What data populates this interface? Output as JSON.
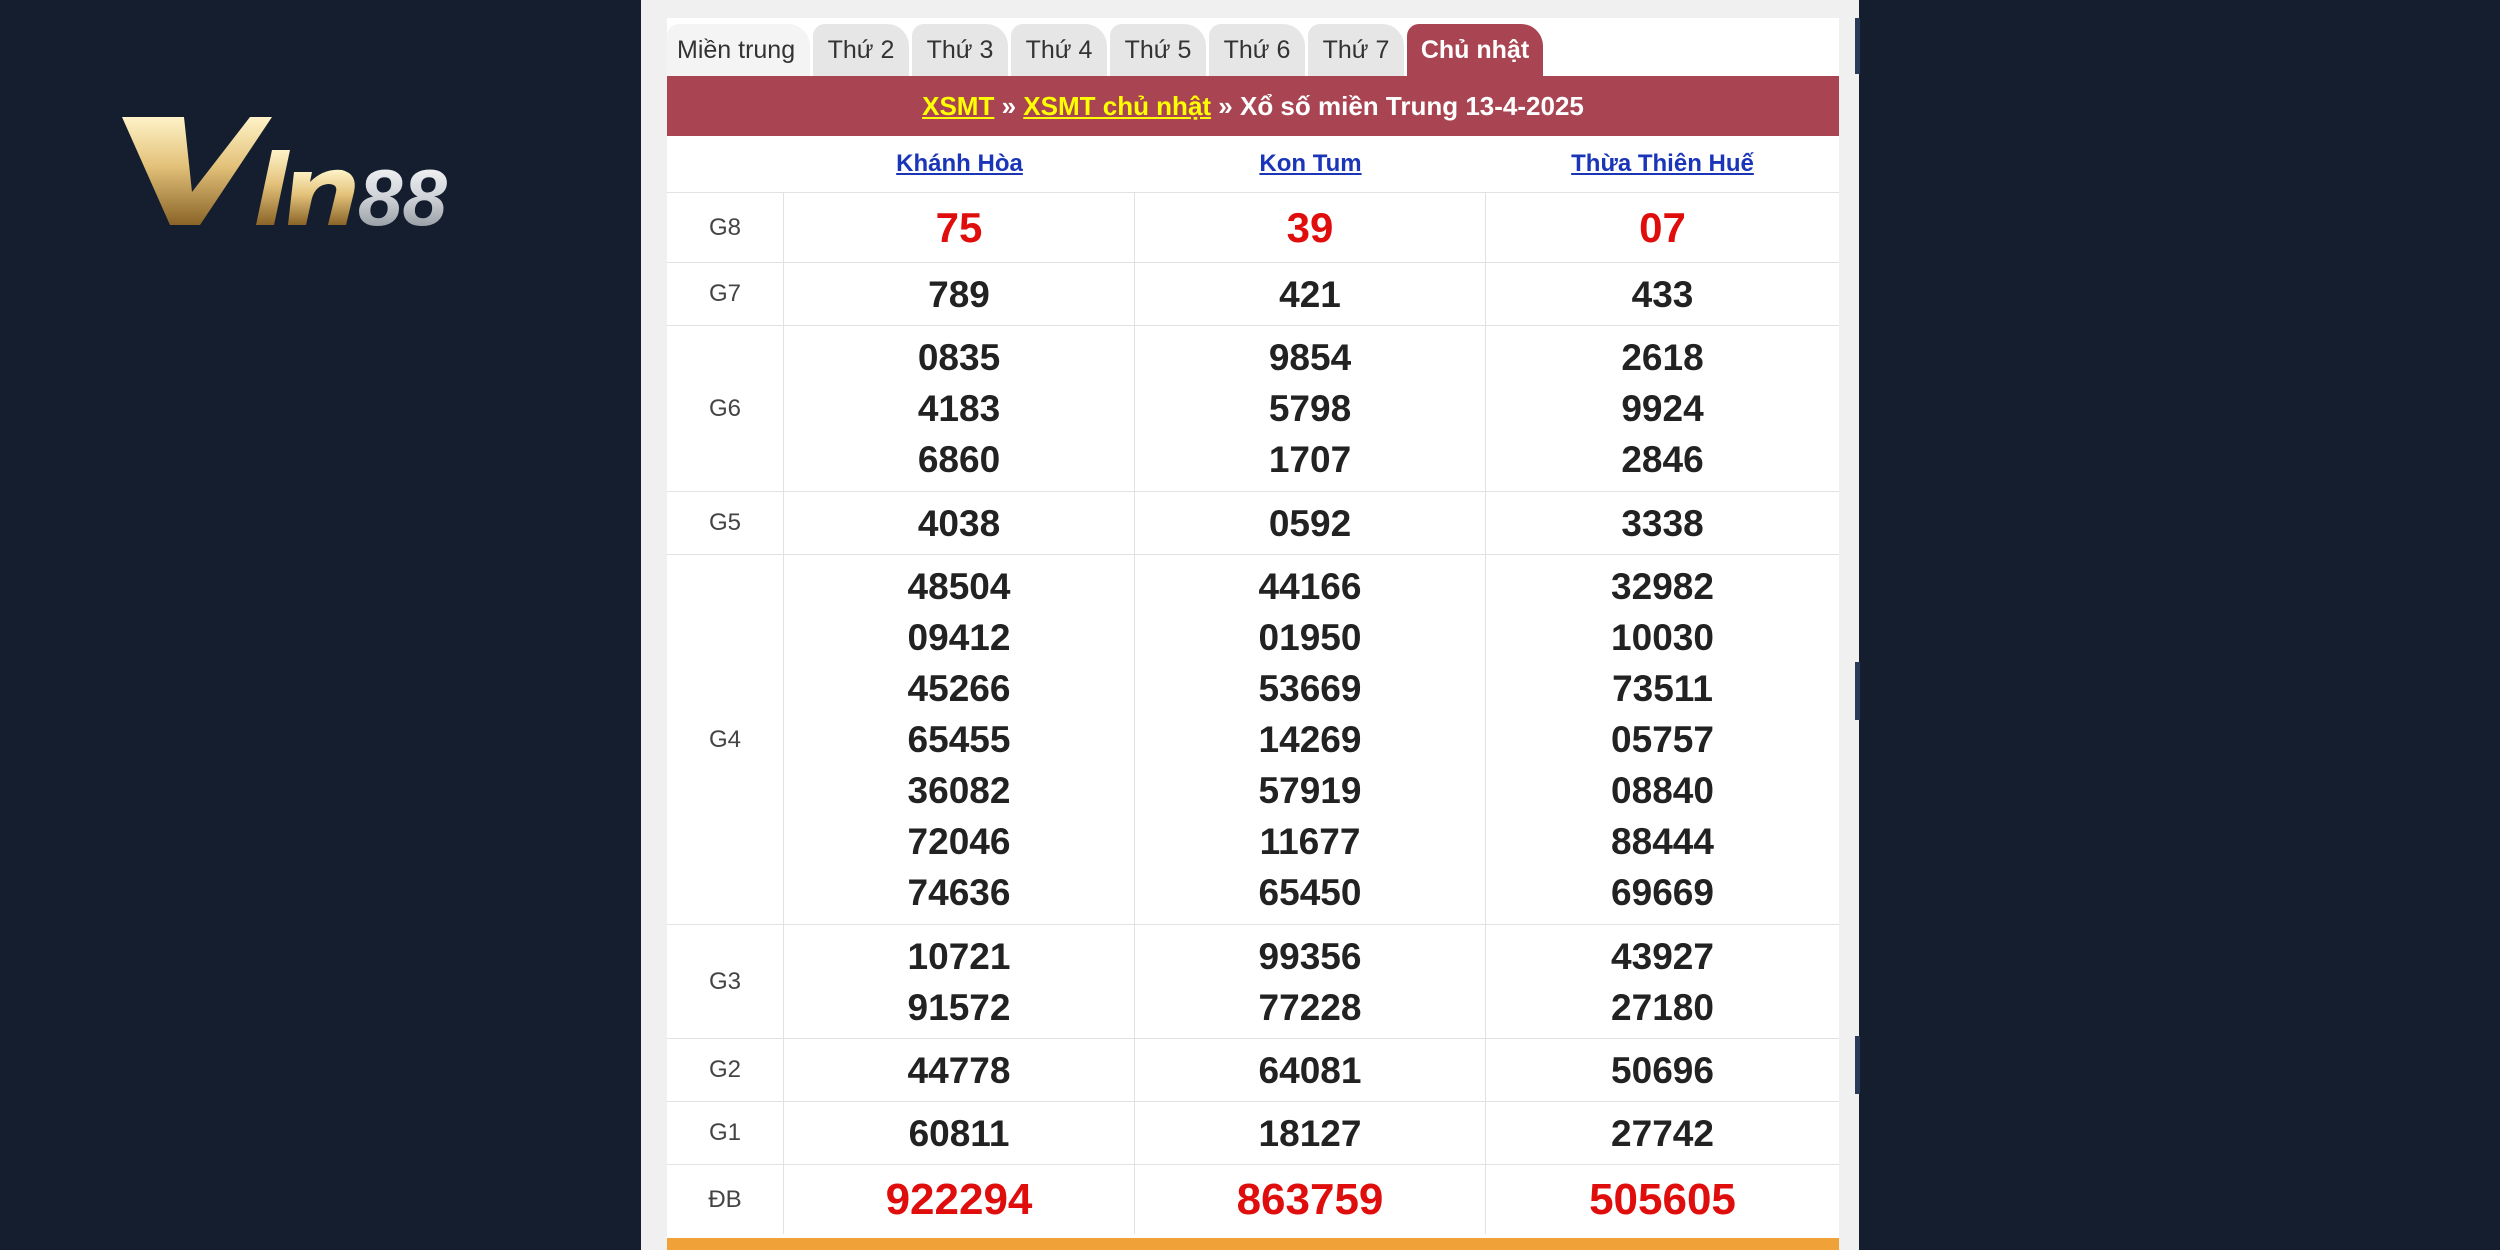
{
  "brand": {
    "logo_text": "Vin88"
  },
  "tabs": [
    {
      "label": "Miền trung"
    },
    {
      "label": "Thứ 2"
    },
    {
      "label": "Thứ 3"
    },
    {
      "label": "Thứ 4"
    },
    {
      "label": "Thứ 5"
    },
    {
      "label": "Thứ 6"
    },
    {
      "label": "Thứ 7"
    },
    {
      "label": "Chủ nhật"
    }
  ],
  "active_tab": "Chủ nhật",
  "title_bar": {
    "link1": "XSMT",
    "sep1": " » ",
    "link2": "XSMT chủ nhật",
    "sep2": " » ",
    "text": "Xổ số miền Trung 13-4-2025"
  },
  "provinces": [
    "Khánh Hòa",
    "Kon Tum",
    "Thừa Thiên Huế"
  ],
  "results": [
    {
      "prize": "G8",
      "values": [
        [
          "75"
        ],
        [
          "39"
        ],
        [
          "07"
        ]
      ]
    },
    {
      "prize": "G7",
      "values": [
        [
          "789"
        ],
        [
          "421"
        ],
        [
          "433"
        ]
      ]
    },
    {
      "prize": "G6",
      "values": [
        [
          "0835",
          "4183",
          "6860"
        ],
        [
          "9854",
          "5798",
          "1707"
        ],
        [
          "2618",
          "9924",
          "2846"
        ]
      ]
    },
    {
      "prize": "G5",
      "values": [
        [
          "4038"
        ],
        [
          "0592"
        ],
        [
          "3338"
        ]
      ]
    },
    {
      "prize": "G4",
      "values": [
        [
          "48504",
          "09412",
          "45266",
          "65455",
          "36082",
          "72046",
          "74636"
        ],
        [
          "44166",
          "01950",
          "53669",
          "14269",
          "57919",
          "11677",
          "65450"
        ],
        [
          "32982",
          "10030",
          "73511",
          "05757",
          "08840",
          "88444",
          "69669"
        ]
      ]
    },
    {
      "prize": "G3",
      "values": [
        [
          "10721",
          "91572"
        ],
        [
          "99356",
          "77228"
        ],
        [
          "43927",
          "27180"
        ]
      ]
    },
    {
      "prize": "G2",
      "values": [
        [
          "44778"
        ],
        [
          "64081"
        ],
        [
          "50696"
        ]
      ]
    },
    {
      "prize": "G1",
      "values": [
        [
          "60811"
        ],
        [
          "18127"
        ],
        [
          "27742"
        ]
      ]
    },
    {
      "prize": "ĐB",
      "values": [
        [
          "922294"
        ],
        [
          "863759"
        ],
        [
          "505605"
        ]
      ]
    }
  ],
  "colors": {
    "background": "#141e2e",
    "accent": "#a94552",
    "link_yellow": "#ffff00",
    "prize_red": "#e00d0d",
    "province_blue": "#1a35b8"
  }
}
